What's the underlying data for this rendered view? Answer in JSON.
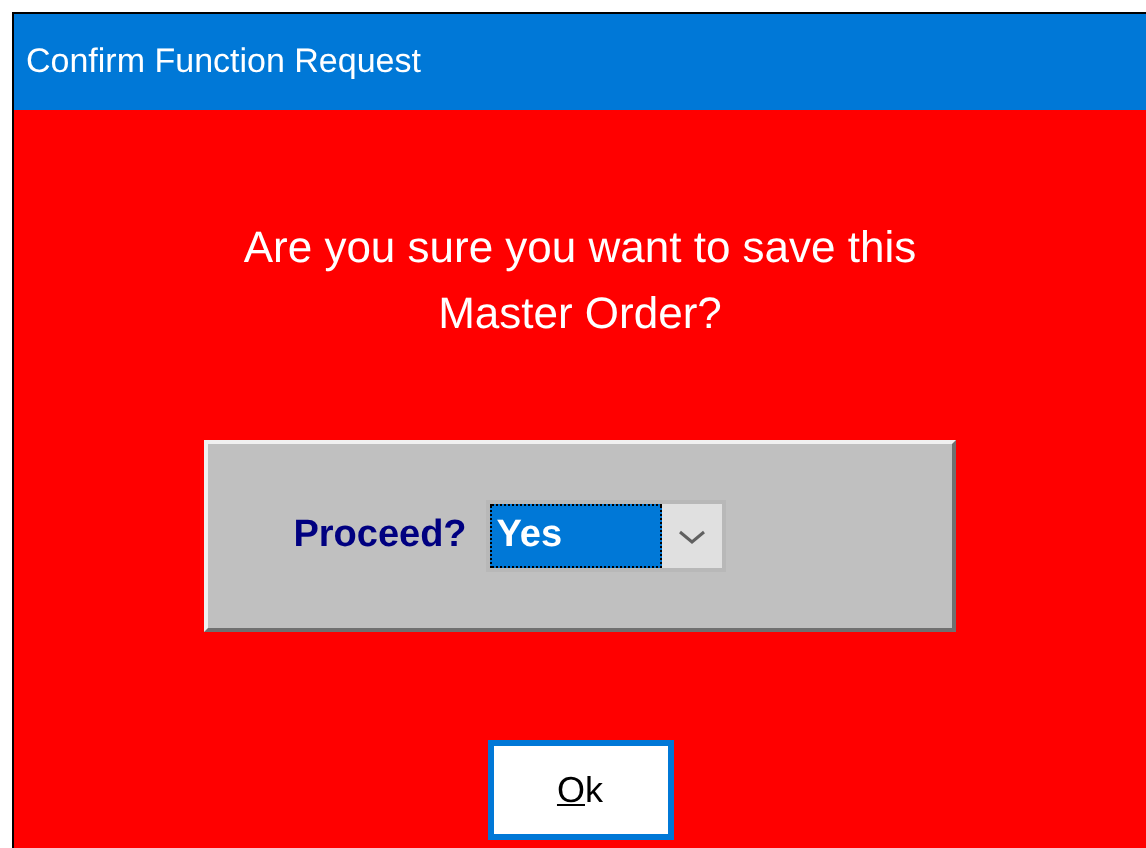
{
  "window": {
    "title": "Confirm Function Request"
  },
  "message": "Are you sure you want to save this Master Order?",
  "proceed": {
    "label": "Proceed?",
    "value": "Yes",
    "focused": true
  },
  "ok_button": {
    "label": "Ok",
    "underline_first": true,
    "focused": true
  }
}
